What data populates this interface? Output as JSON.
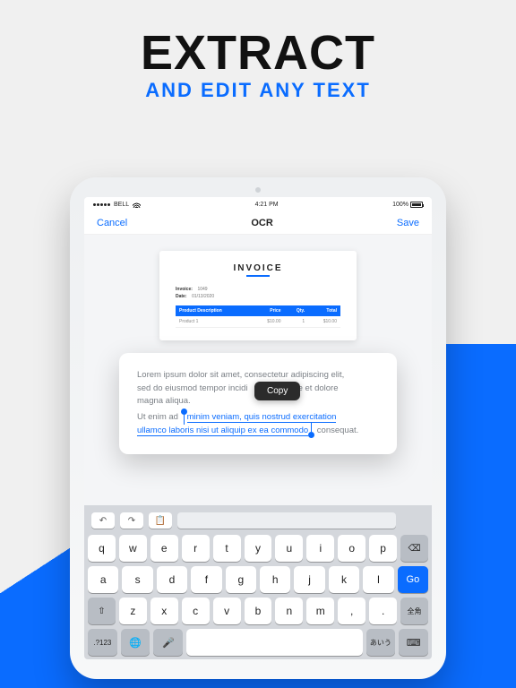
{
  "headline": {
    "big": "EXTRACT",
    "sub": "AND EDIT ANY TEXT"
  },
  "status": {
    "carrier": "BELL",
    "time": "4:21 PM",
    "battery": "100%"
  },
  "nav": {
    "cancel": "Cancel",
    "title": "OCR",
    "save": "Save"
  },
  "invoice": {
    "title": "INVOICE",
    "meta": {
      "invoice_label": "Invoice:",
      "invoice_val": "1049",
      "date_label": "Date:",
      "date_val": "01/13/2020"
    },
    "columns": [
      "Product Description",
      "Price",
      "Qty.",
      "Total"
    ],
    "row": [
      "Product 1",
      "$10.00",
      "1",
      "$10.00"
    ]
  },
  "ocr": {
    "line1": "Lorem ipsum dolor sit amet, consectetur adipiscing elit,",
    "line2": "sed do eiusmod tempor incidi",
    "line2b": "re et dolore",
    "line3": "magna aliqua.",
    "sel_a": "Ut enim ad ",
    "sel_b": "minim veniam, quis nostrud exercitation",
    "sel_c": "ullamco laboris nisi ut aliquip ex ea commodo",
    "sel_d": " consequat."
  },
  "popup": {
    "copy": "Copy"
  },
  "keyboard": {
    "undo": "↶",
    "redo": "↷",
    "paste_icon": "📋",
    "row1": [
      "q",
      "w",
      "e",
      "r",
      "t",
      "y",
      "u",
      "i",
      "o",
      "p"
    ],
    "row2": [
      "a",
      "s",
      "d",
      "f",
      "g",
      "h",
      "j",
      "k",
      "l"
    ],
    "row3": [
      "z",
      "x",
      "c",
      "v",
      "b",
      "n",
      "m"
    ],
    "shift": "⇧",
    "backspace": "⌫",
    "numbers": ".?123",
    "globe": "🌐",
    "mic": "🎤",
    "hide": "⌨",
    "go": "Go",
    "alt1": "あいう",
    "alt2": "全角"
  }
}
